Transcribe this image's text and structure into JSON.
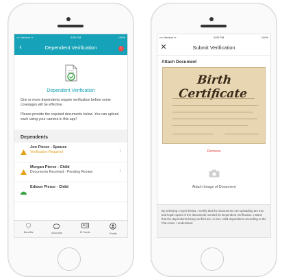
{
  "left_screen": {
    "status": {
      "carrier": "•••• Verizon ᯤ",
      "time": "8:00 PM",
      "battery": "100%"
    },
    "nav": {
      "back_icon": "chevron-left-icon",
      "title": "Dependent Verification",
      "alert_count": "!"
    },
    "heading": "Dependent Verification",
    "paragraph_1": "One or more dependents require verification before some coverages will be effective.",
    "paragraph_2": "Please provide the required documents below. You can upload each using your camera in this app!",
    "dependents_title": "Dependents",
    "dependents": [
      {
        "name": "Jon Pierce - Spouse",
        "status": "Verification Required"
      },
      {
        "name": "Morgan Pierce - Child",
        "status": "Documents Received - Pending Review"
      },
      {
        "name": "Edison Pierce - Child",
        "status": ""
      }
    ],
    "tabs": [
      {
        "label": "Benefits",
        "icon": "shield-icon"
      },
      {
        "label": "Accounts",
        "icon": "piggy-bank-icon"
      },
      {
        "label": "ID Cards",
        "icon": "id-card-icon"
      },
      {
        "label": "Profile",
        "icon": "user-icon"
      }
    ]
  },
  "right_screen": {
    "status": {
      "carrier": "•••• Verizon ᯤ",
      "time": "8:00 PM",
      "battery": "100%"
    },
    "nav": {
      "close_icon": "close-icon",
      "title": "Submit Verification"
    },
    "attach_title": "Attach Document",
    "certificate_text": "Birth Certificate",
    "remove_label": "Remove",
    "attach_image_label": "Attach Image of Document",
    "legal_text": "By selecting I Agree below, I certify that the documents I am uploading are true and legal copies of the documents needed for Dependent Verification. I attest that the dependents being verified are, in fact, valid dependents according to the Plan rules. I understand"
  },
  "colors": {
    "primary": "#16a2b8",
    "warning": "#e3a21a",
    "danger": "#e94a4a"
  }
}
